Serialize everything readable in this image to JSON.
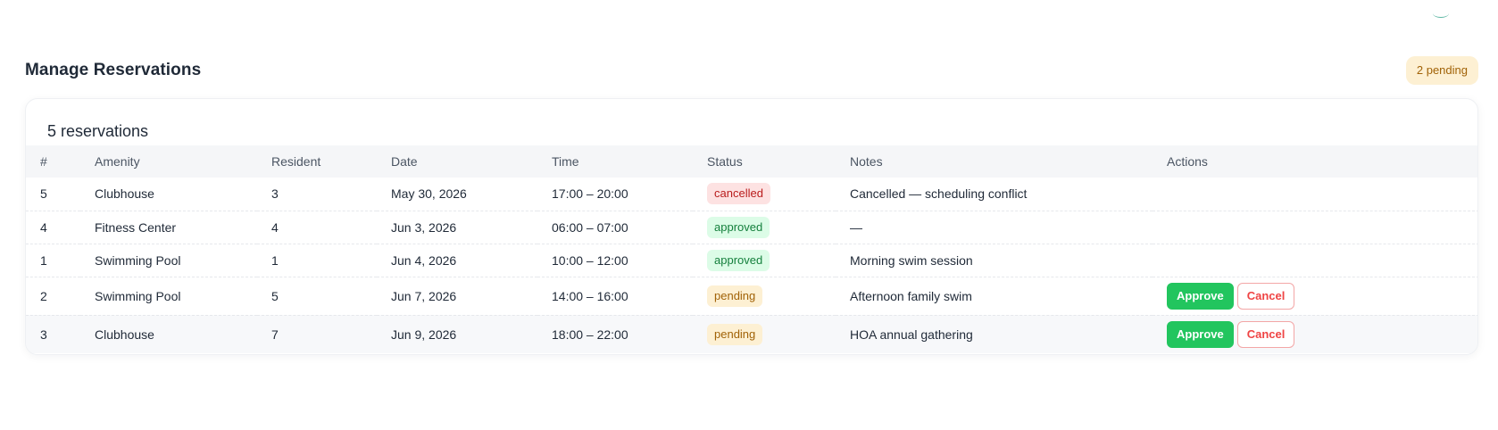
{
  "page": {
    "title": "Manage Reservations",
    "pending_badge": "2 pending"
  },
  "card": {
    "title": "5 reservations"
  },
  "table": {
    "columns": [
      "#",
      "Amenity",
      "Resident",
      "Date",
      "Time",
      "Status",
      "Notes",
      "Actions"
    ],
    "rows": [
      {
        "id": "5",
        "amenity": "Clubhouse",
        "resident": "3",
        "date": "May 30, 2026",
        "time": "17:00 – 20:00",
        "status": "cancelled",
        "notes": "Cancelled — scheduling conflict"
      },
      {
        "id": "4",
        "amenity": "Fitness Center",
        "resident": "4",
        "date": "Jun 3, 2026",
        "time": "06:00 – 07:00",
        "status": "approved",
        "notes": "—"
      },
      {
        "id": "1",
        "amenity": "Swimming Pool",
        "resident": "1",
        "date": "Jun 4, 2026",
        "time": "10:00 – 12:00",
        "status": "approved",
        "notes": "Morning swim session"
      },
      {
        "id": "2",
        "amenity": "Swimming Pool",
        "resident": "5",
        "date": "Jun 7, 2026",
        "time": "14:00 – 16:00",
        "status": "pending",
        "notes": "Afternoon family swim",
        "actions": {
          "approve": "Approve",
          "cancel": "Cancel"
        }
      },
      {
        "id": "3",
        "amenity": "Clubhouse",
        "resident": "7",
        "date": "Jun 9, 2026",
        "time": "18:00 – 22:00",
        "status": "pending",
        "notes": "HOA annual gathering",
        "actions": {
          "approve": "Approve",
          "cancel": "Cancel"
        }
      }
    ]
  },
  "colors": {
    "approve": "#22c55e",
    "cancel": "#ef4444",
    "pending_bg": "#fdf0d3",
    "approved_bg": "#dcfce7",
    "cancelled_bg": "#fde2e2"
  }
}
